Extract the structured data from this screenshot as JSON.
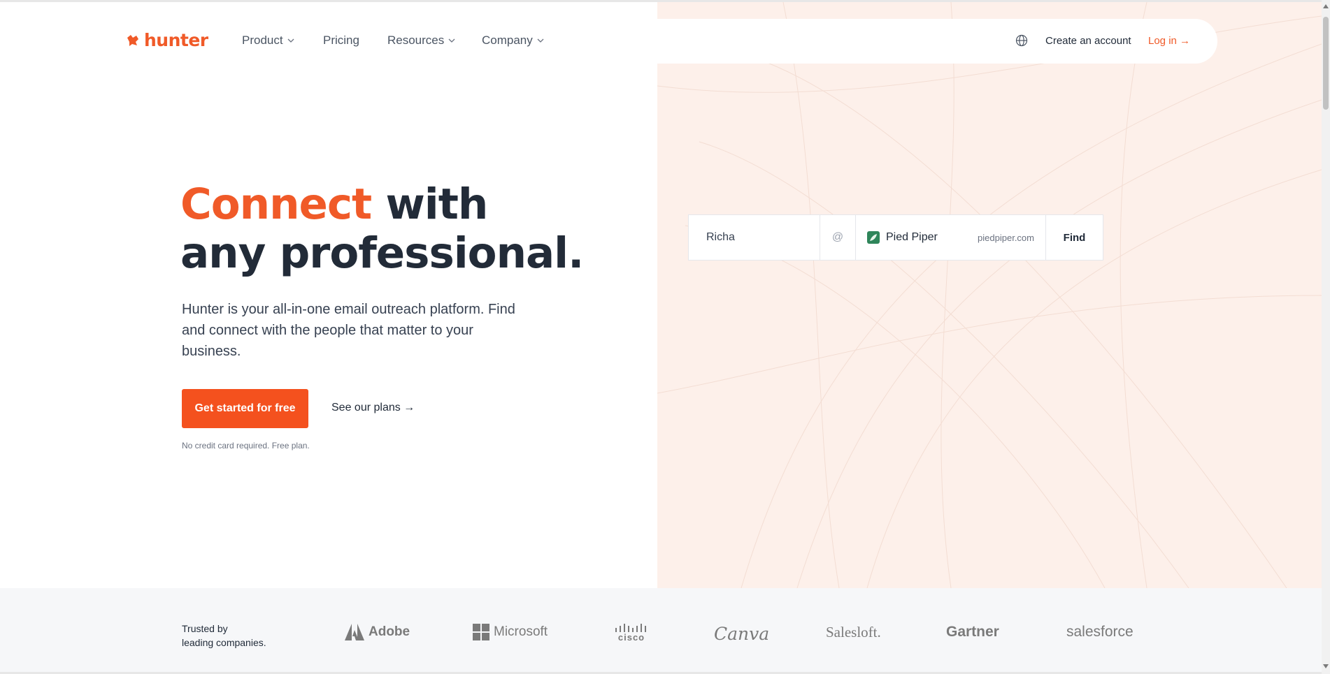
{
  "brand": {
    "name": "hunter",
    "accent_color": "#f05a28",
    "logo_icon": "fox-head-icon"
  },
  "nav": {
    "items": [
      {
        "label": "Product",
        "has_dropdown": true
      },
      {
        "label": "Pricing",
        "has_dropdown": false
      },
      {
        "label": "Resources",
        "has_dropdown": true
      },
      {
        "label": "Company",
        "has_dropdown": true
      }
    ],
    "language_icon": "globe-icon",
    "create_account": "Create an account",
    "login": "Log in →"
  },
  "hero": {
    "title_accent": "Connect",
    "title_rest_line1": " with",
    "title_line2": "any professional.",
    "subtitle": "Hunter is your all-in-one email outreach platform. Find and connect with the people that matter to your business.",
    "cta_primary": "Get started for free",
    "cta_secondary": "See our plans →",
    "fine_print": "No credit card required. Free plan."
  },
  "finder": {
    "name_value": "Richa",
    "at_symbol": "@",
    "company_name": "Pied Piper",
    "company_domain": "piedpiper.com",
    "button_label": "Find"
  },
  "trusted": {
    "label_line1": "Trusted by",
    "label_line2": "leading companies.",
    "companies": [
      "Adobe",
      "Microsoft",
      "cisco",
      "Canva",
      "Salesloft.",
      "Gartner",
      "salesforce"
    ]
  },
  "colors": {
    "hero_panel_bg": "#fdf0ea",
    "trusted_bg": "#f6f7f9",
    "cta_bg": "#f4511e",
    "heading": "#222b38"
  }
}
